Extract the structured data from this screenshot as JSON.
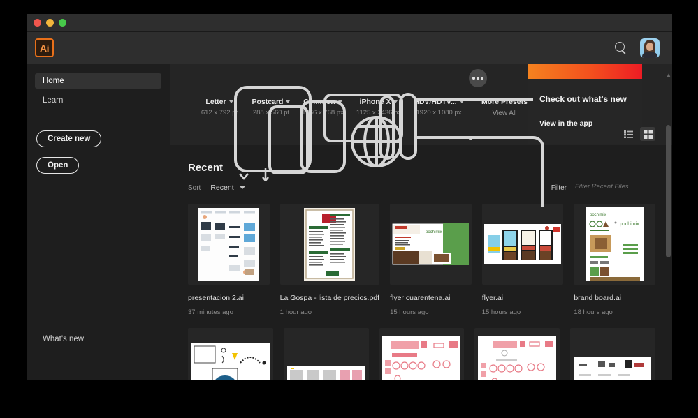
{
  "window": {
    "traffic_lights": [
      "close",
      "minimize",
      "zoom"
    ]
  },
  "appbar": {
    "logo_text": "Ai",
    "search_icon": "search-icon",
    "avatar_label": "user-avatar"
  },
  "sidebar": {
    "items": [
      {
        "label": "Home",
        "active": true
      },
      {
        "label": "Learn",
        "active": false
      }
    ],
    "buttons": [
      {
        "label": "Create new"
      },
      {
        "label": "Open"
      }
    ],
    "whats_new": "What's new"
  },
  "presets": {
    "items": [
      {
        "name": "Letter",
        "size": "612 x 792 pt"
      },
      {
        "name": "Postcard",
        "size": "288 x 560 pt"
      },
      {
        "name": "Common",
        "size": "1366 x 768 px"
      },
      {
        "name": "iPhone X",
        "size": "1125 x 2436 px"
      },
      {
        "name": "HDV/HDTV...",
        "size": "1920 x 1080 px"
      }
    ],
    "more": {
      "title": "More Presets",
      "subtitle": "View All"
    },
    "more_options_icon": "more-options-icon"
  },
  "whats_new_card": {
    "title": "Check out what's new",
    "link": "View in the app"
  },
  "recent": {
    "title": "Recent",
    "sort_label": "Sort",
    "sort_value": "Recent",
    "filter_label": "Filter",
    "filter_placeholder": "Filter Recent Files",
    "view_list_icon": "list-view-icon",
    "view_grid_icon": "grid-view-icon",
    "active_view": "grid",
    "files": [
      {
        "name": "presentacion 2.ai",
        "time": "37 minutes ago"
      },
      {
        "name": "La Gospa - lista de precios.pdf",
        "time": "1 hour ago"
      },
      {
        "name": "flyer cuarentena.ai",
        "time": "15 hours ago"
      },
      {
        "name": "flyer.ai",
        "time": "15 hours ago"
      },
      {
        "name": "brand board.ai",
        "time": "18 hours ago"
      }
    ]
  },
  "colors": {
    "accent_orange": "#e8701a",
    "banner_start": "#f5821f",
    "banner_end": "#ec1c24",
    "window_bg": "#1e1e1e",
    "chrome_bg": "#2e2e2e",
    "card_bg": "#262626"
  }
}
